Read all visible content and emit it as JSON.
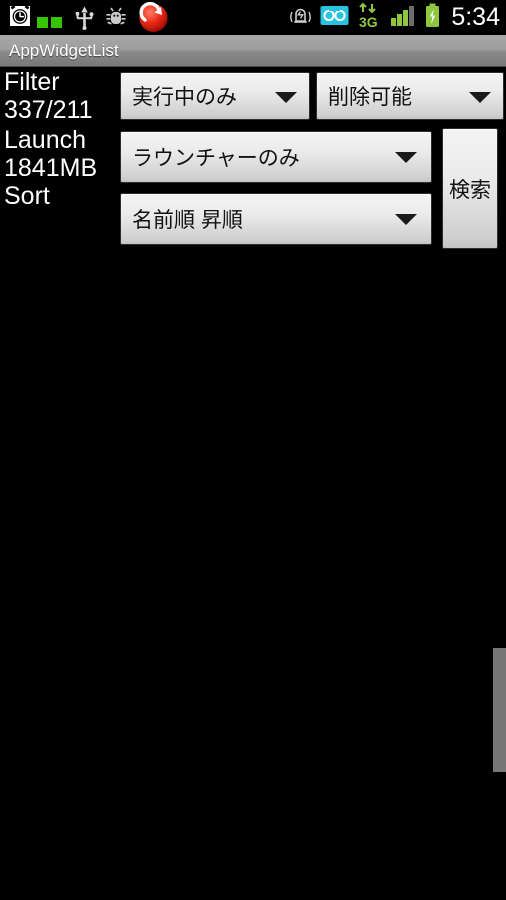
{
  "status_bar": {
    "background": "#000000",
    "time": "5:34",
    "left_icons": [
      {
        "name": "alarm-clock-icon",
        "label": "alarm-clock"
      },
      {
        "name": "memory-widget-indicator-icon",
        "label": "memory-widget"
      },
      {
        "name": "usb-icon",
        "label": "usb-connected"
      },
      {
        "name": "android-debug-icon",
        "label": "usb-debugging"
      },
      {
        "name": "red-sync-icon",
        "label": "sync-active"
      }
    ],
    "right_icons": [
      {
        "name": "vibrate-ringer-icon",
        "label": "vibrate"
      },
      {
        "name": "voicemail-icon",
        "label": "voicemail",
        "color": "#28c3e0"
      },
      {
        "name": "data-3g-icon",
        "label": "3G",
        "text": "3G",
        "color": "#8ec640"
      },
      {
        "name": "signal-strength-icon",
        "label": "signal",
        "bars_total": 4,
        "bars_active": 3,
        "color": "#8ec640"
      },
      {
        "name": "battery-charging-icon",
        "label": "battery-charging",
        "color": "#8ec640"
      }
    ]
  },
  "title_bar": {
    "title": "AppWidgetList"
  },
  "controls": {
    "rows": [
      {
        "labels": [
          "Filter",
          "337/211"
        ],
        "spinners": [
          {
            "name": "filter-running-spinner",
            "value": "実行中のみ"
          },
          {
            "name": "filter-removable-spinner",
            "value": "削除可能"
          }
        ]
      },
      {
        "labels": [
          "Launch",
          "1841MB"
        ],
        "spinners": [
          {
            "name": "launch-type-spinner",
            "value": "ラウンチャーのみ"
          }
        ]
      },
      {
        "labels": [
          "Sort"
        ],
        "spinners": [
          {
            "name": "sort-order-spinner",
            "value": "名前順 昇順"
          }
        ]
      }
    ],
    "search_button": {
      "name": "search-button",
      "label": "検索"
    }
  },
  "list": {
    "items": [],
    "empty": true,
    "scrollbar": {
      "visible": true,
      "color": "#777777"
    }
  },
  "colors": {
    "background": "#000000",
    "text": "#ffffff",
    "title_bar_top": "#a9a9a9",
    "title_bar_bottom": "#787878",
    "spinner_top": "#f4f4f4",
    "spinner_bottom": "#c3c3c3",
    "accent_green": "#8ec640",
    "accent_cyan": "#28c3e0",
    "accent_red": "#e01b1b"
  }
}
